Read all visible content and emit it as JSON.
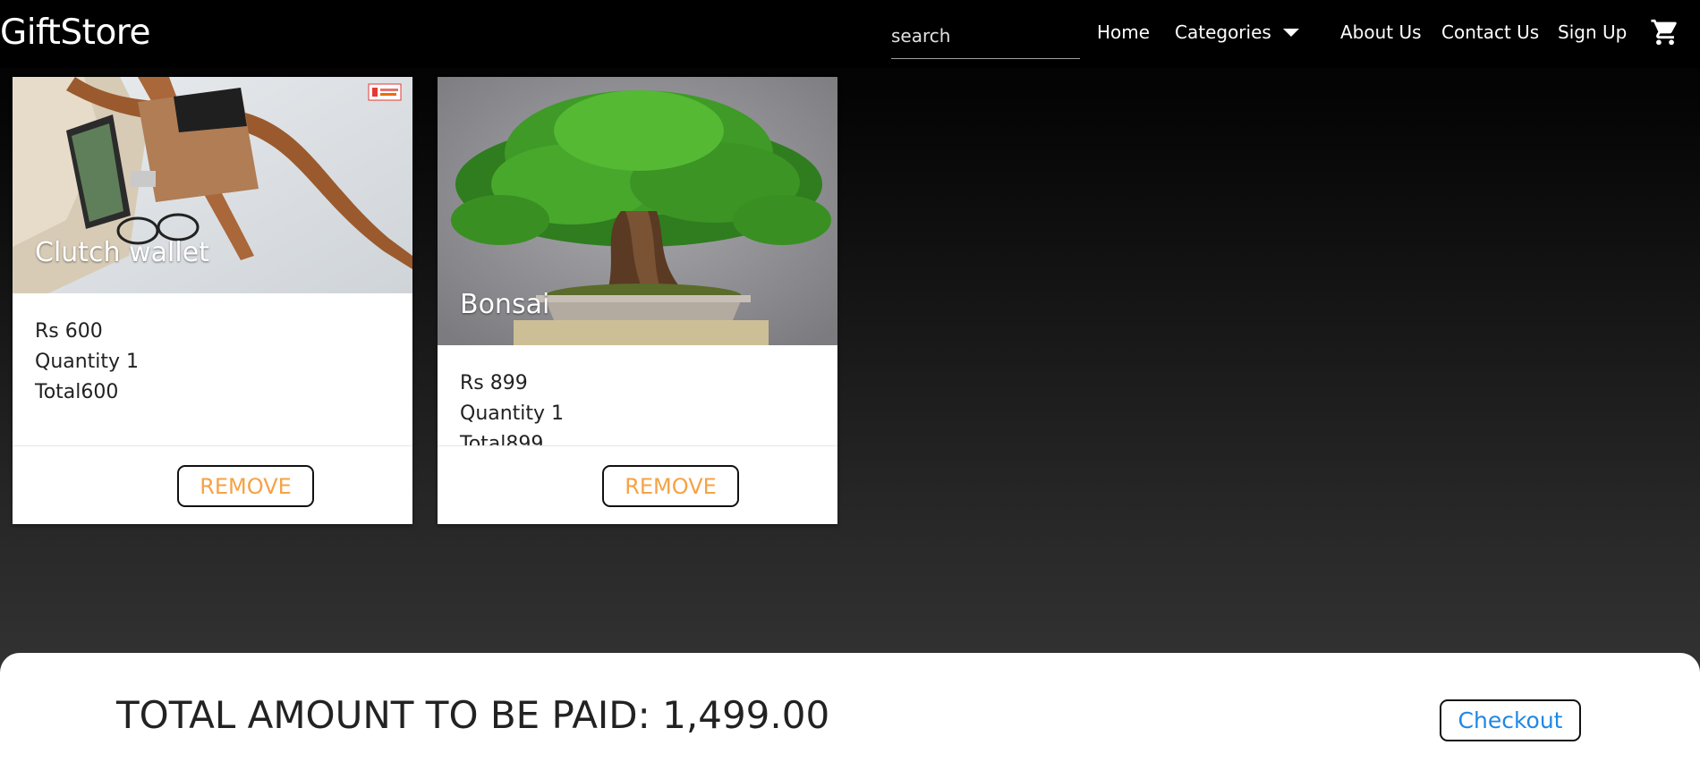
{
  "navbar": {
    "brand": "GiftStore",
    "search_placeholder": "search",
    "links": {
      "home": "Home",
      "categories": "Categories",
      "about": "About Us",
      "contact": "Contact Us",
      "signup": "Sign Up"
    },
    "icons": {
      "dropdown": "caret-down-icon",
      "cart": "shopping-cart-icon"
    }
  },
  "cart_items": [
    {
      "title": "Clutch wallet",
      "price": "Rs 600",
      "quantity": "Quantity 1",
      "total": "Total600",
      "remove_label": "REMOVE"
    },
    {
      "title": "Bonsai",
      "price": "Rs 899",
      "quantity": "Quantity 1",
      "total": "Total899",
      "remove_label": "REMOVE"
    }
  ],
  "summary": {
    "total_text": "TOTAL AMOUNT TO BE PAID: 1,499.00",
    "checkout_label": "Checkout"
  },
  "colors": {
    "remove_text": "#f7a245",
    "checkout_text": "#1e88e5",
    "navbar_bg": "#000000"
  }
}
